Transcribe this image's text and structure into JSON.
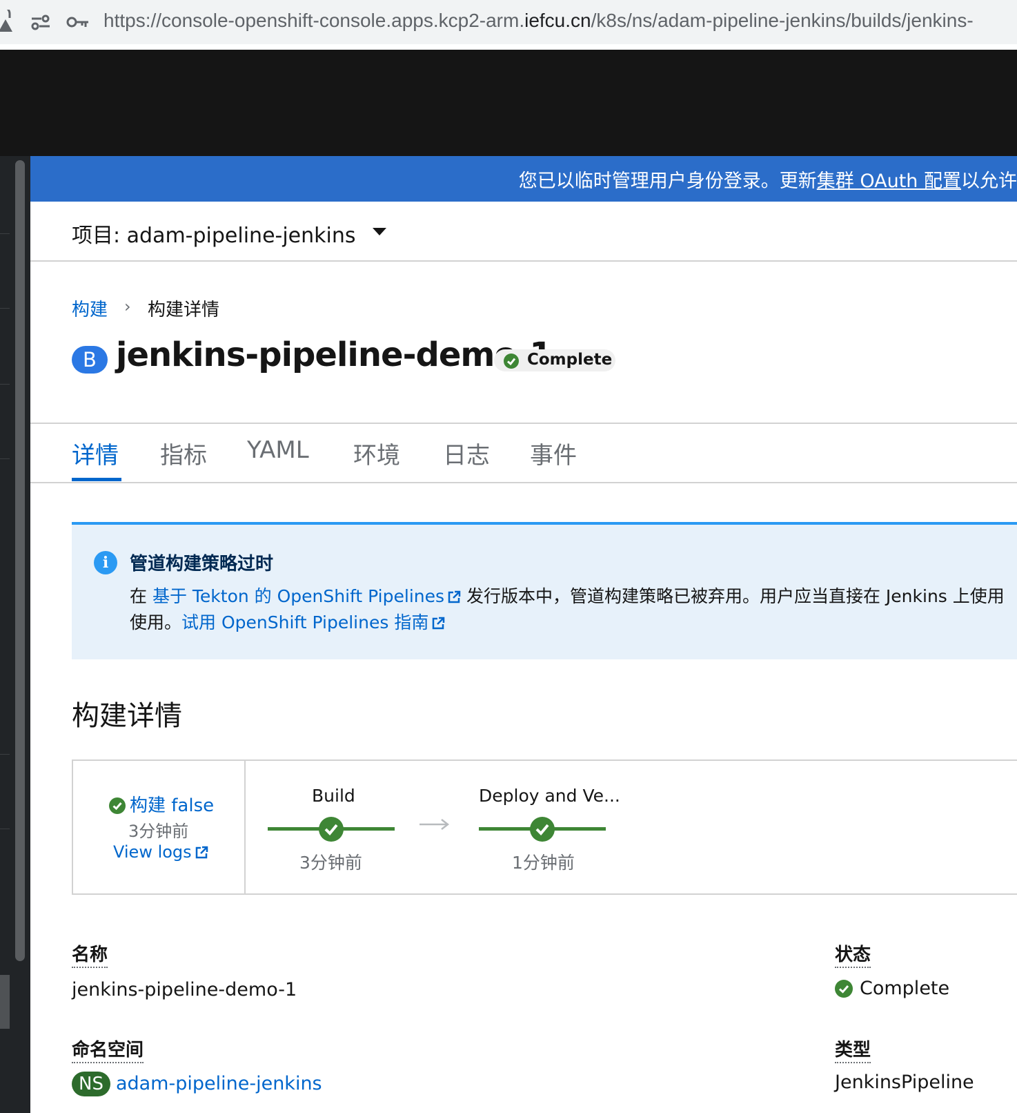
{
  "browser": {
    "url_prefix": "https://console-openshift-console.apps.kcp2-arm.",
    "url_host": "iefcu.cn",
    "url_suffix": "/k8s/ns/adam-pipeline-jenkins/builds/jenkins-"
  },
  "banner": {
    "text_before": "您已以临时管理用户身份登录。更新",
    "link": "集群 OAuth 配置",
    "text_after": "以允许"
  },
  "project": {
    "label": "项目: adam-pipeline-jenkins"
  },
  "breadcrumb": {
    "parent": "构建",
    "separator": "›",
    "current": "构建详情"
  },
  "header": {
    "badge": "B",
    "title": "jenkins-pipeline-demo-1",
    "status": "Complete"
  },
  "tabs": [
    {
      "label": "详情"
    },
    {
      "label": "指标"
    },
    {
      "label": "YAML"
    },
    {
      "label": "环境"
    },
    {
      "label": "日志"
    },
    {
      "label": "事件"
    }
  ],
  "alert": {
    "title": "管道构建策略过时",
    "line1_prefix": "在 ",
    "line1_link": "基于 Tekton 的 OpenShift Pipelines",
    "line1_suffix": " 发行版本中，管道构建策略已被弃用。用户应当直接在 Jenkins 上使用",
    "line2_prefix": "使用。",
    "line2_link": "试用 OpenShift Pipelines 指南"
  },
  "section": {
    "title": "构建详情"
  },
  "pipeline": {
    "build_status": "构建 false",
    "build_time": "3分钟前",
    "view_logs": "View logs",
    "stages": [
      {
        "name": "Build",
        "time": "3分钟前"
      },
      {
        "name": "Deploy and Ve...",
        "time": "1分钟前"
      }
    ]
  },
  "details": {
    "name_label": "名称",
    "name_value": "jenkins-pipeline-demo-1",
    "namespace_label": "命名空间",
    "namespace_badge": "NS",
    "namespace_value": "adam-pipeline-jenkins",
    "status_label": "状态",
    "status_value": "Complete",
    "type_label": "类型",
    "type_value": "JenkinsPipeline"
  },
  "colors": {
    "banner": "#2b6dc9",
    "link": "#0066cc",
    "success": "#3e8635",
    "masthead": "#151515"
  }
}
